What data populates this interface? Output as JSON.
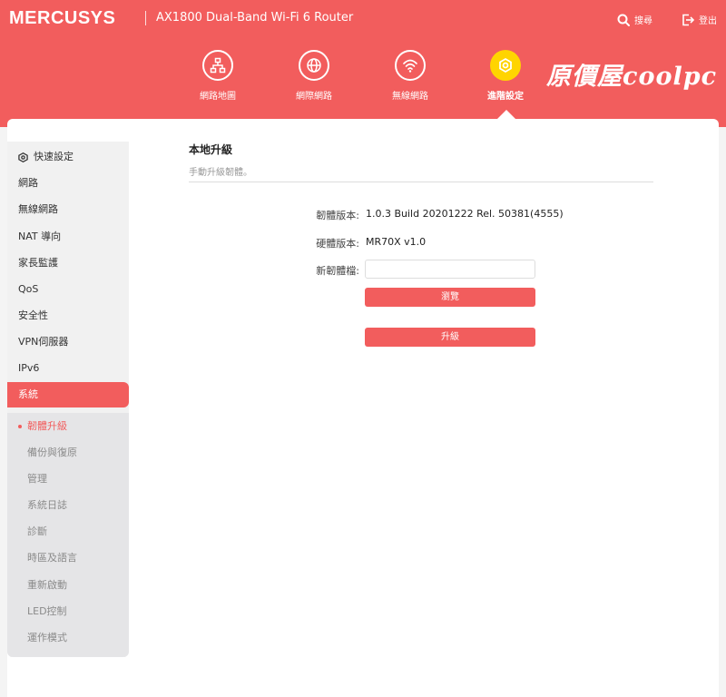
{
  "header": {
    "brand": "MERCUSYS",
    "model": "AX1800 Dual-Band Wi-Fi 6 Router",
    "search_label": "搜尋",
    "logout_label": "登出",
    "watermark": "原價屋coolpc"
  },
  "nav": [
    {
      "label": "網路地圖",
      "icon": "network-map-icon"
    },
    {
      "label": "網際網路",
      "icon": "globe-icon"
    },
    {
      "label": "無線網路",
      "icon": "wifi-icon"
    },
    {
      "label": "進階設定",
      "icon": "gear-icon",
      "active": true
    }
  ],
  "sidebar": {
    "items": [
      {
        "label": "快速設定"
      },
      {
        "label": "網路"
      },
      {
        "label": "無線網路"
      },
      {
        "label": "NAT 導向"
      },
      {
        "label": "家長監護"
      },
      {
        "label": "QoS"
      },
      {
        "label": "安全性"
      },
      {
        "label": "VPN伺服器"
      },
      {
        "label": "IPv6"
      },
      {
        "label": "系統",
        "active": true
      }
    ],
    "sub_items": [
      {
        "label": "韌體升級",
        "active": true
      },
      {
        "label": "備份與復原"
      },
      {
        "label": "管理"
      },
      {
        "label": "系統日誌"
      },
      {
        "label": "診斷"
      },
      {
        "label": "時區及語言"
      },
      {
        "label": "重新啟動"
      },
      {
        "label": "LED控制"
      },
      {
        "label": "運作模式"
      }
    ]
  },
  "main": {
    "title": "本地升級",
    "description": "手動升級韌體。",
    "firmware_label": "韌體版本:",
    "firmware_value": "1.0.3 Build 20201222 Rel. 50381(4555)",
    "hardware_label": "硬體版本:",
    "hardware_value": "MR70X v1.0",
    "new_firmware_label": "新韌體檔:",
    "new_firmware_value": "",
    "browse_label": "瀏覽",
    "upgrade_label": "升級"
  },
  "colors": {
    "accent": "#f25d5d",
    "active_nav": "#ffd400"
  }
}
